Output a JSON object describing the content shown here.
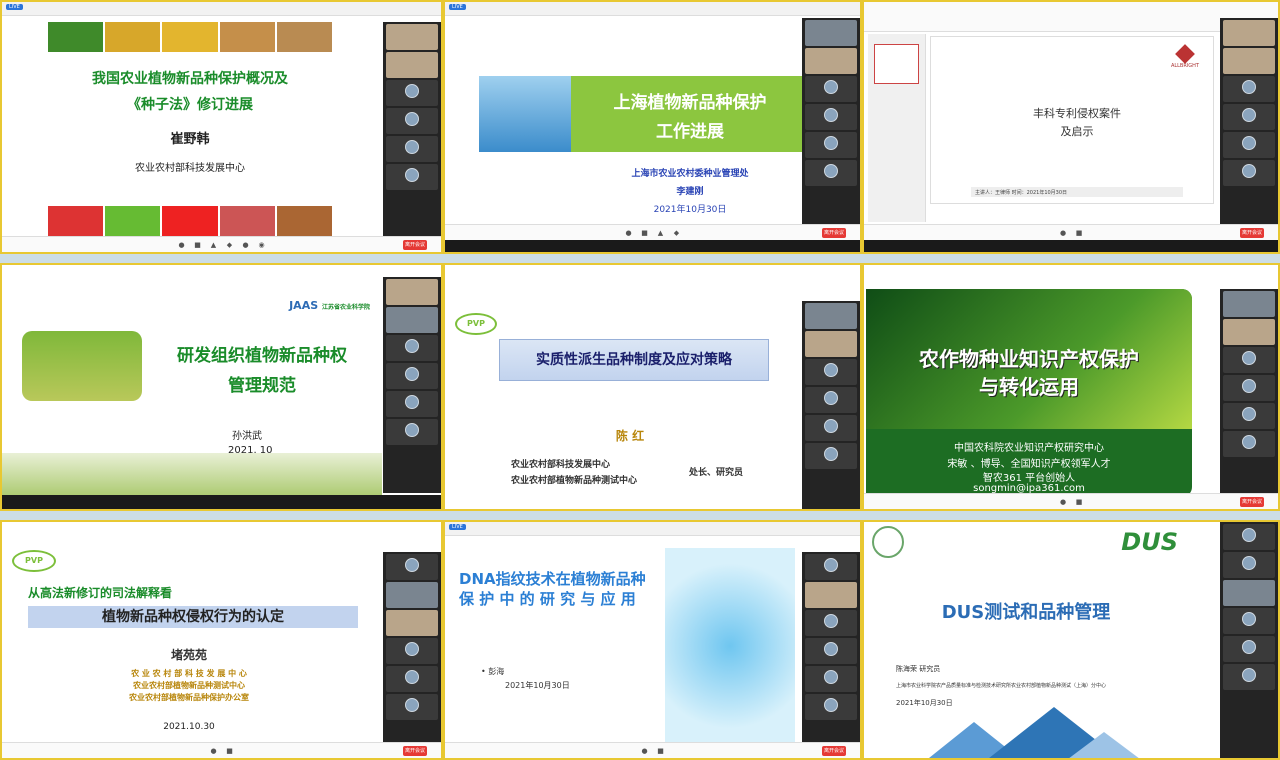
{
  "tiles": {
    "t1": {
      "slide_title_1": "我国农业植物新品种保护概况及",
      "slide_title_2": "《种子法》修订进展",
      "speaker": "崔野韩",
      "org": "农业农村部科技发展中心",
      "live_label": "LIVE",
      "leave_button": "离开会议"
    },
    "t2": {
      "title_1": "上海植物新品种保护",
      "title_2": "工作进展",
      "org": "上海市农业农村委种业管理处",
      "speaker": "李建刚",
      "date": "2021年10月30日",
      "live_label": "LIVE",
      "leave_button": "离开会议"
    },
    "t3": {
      "title_1": "丰科专利侵权案件",
      "title_2": "及启示",
      "logo_text": "ALLBRIGHT",
      "footer": "主讲人：王律师    时间：2021年10月30日",
      "leave_button": "离开会议"
    },
    "t4": {
      "logo": "JAAS",
      "institute": "江苏省农业科学院",
      "title_1": "研发组织植物新品种权",
      "title_2": "管理规范",
      "speaker": "孙洪武",
      "date": "2021. 10"
    },
    "t5": {
      "logo": "PVP",
      "title": "实质性派生品种制度及应对策略",
      "speaker": "陈  红",
      "org_1": "农业农村部科技发展中心",
      "org_2": "农业农村部植物新品种测试中心",
      "role": "处长、研究员"
    },
    "t6": {
      "title_1": "农作物种业知识产权保护",
      "title_2": "与转化运用",
      "org": "中国农科院农业知识产权研究中心",
      "speaker": "宋敏 、博导、全国知识产权领军人才",
      "platform": "智农361 平台创始人",
      "email": "songmin@ipa361.com",
      "leave_button": "离开会议"
    },
    "t7": {
      "logo": "PVP",
      "subtitle": "从高法新修订的司法解释看",
      "title": "植物新品种权侵权行为的认定",
      "speaker": "堵苑苑",
      "org_1": "农 业 农 村 部 科 技 发 展 中 心",
      "org_2": "农业农村部植物新品种测试中心",
      "org_3": "农业农村部植物新品种保护办公室",
      "date": "2021.10.30",
      "leave_button": "离开会议"
    },
    "t8": {
      "title_1": "DNA指纹技术在植物新品种",
      "title_2": "保 护 中 的 研 究 与 应 用",
      "speaker": "彭海",
      "date": "2021年10月30日",
      "live_label": "LIVE",
      "leave_button": "离开会议"
    },
    "t9": {
      "logo": "DUS",
      "title": "DUS测试和品种管理",
      "speaker": "陈海荣  研究员",
      "org": "上海市农业科学院农产品质量标准与检测技术研究所农业农村部植物新品种测试（上海）分中心",
      "date": "2021年10月30日"
    }
  },
  "colors": {
    "border": "#e8c832",
    "accent_green": "#1a8c2a",
    "leave_red": "#e53935"
  }
}
